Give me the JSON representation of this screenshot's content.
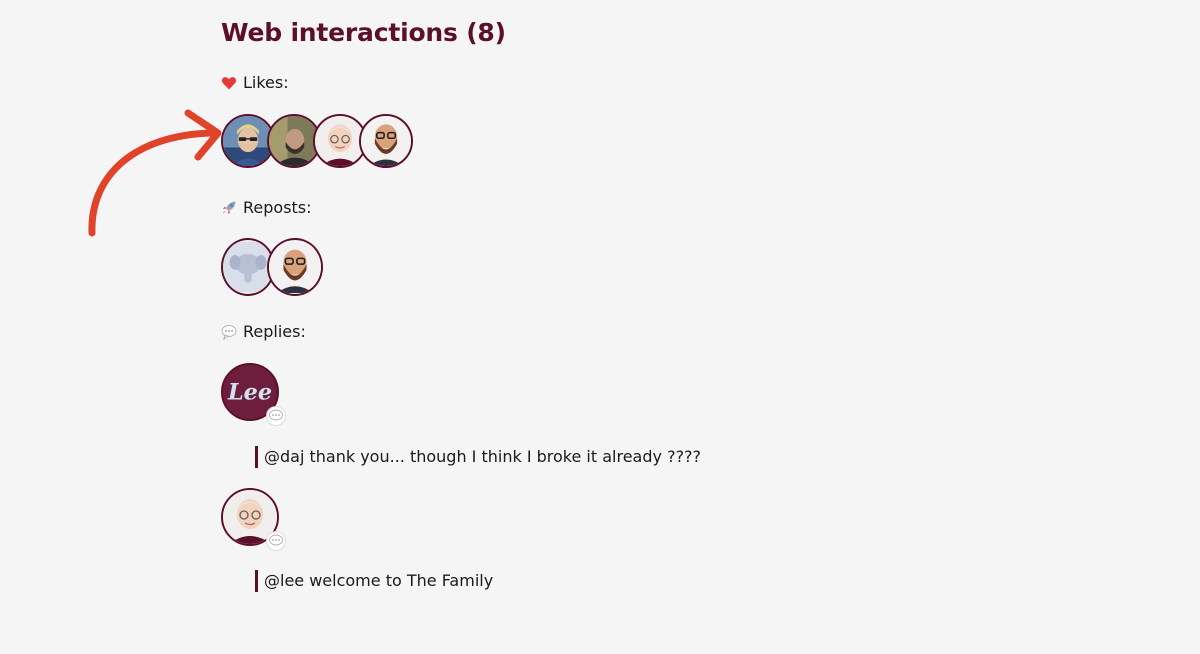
{
  "interactions": {
    "title": "Web interactions (8)",
    "likes": {
      "label": "Likes:",
      "icon": "heart-icon",
      "avatars": [
        "avatar-blonde-sunglasses",
        "avatar-beard-dark",
        "avatar-cartoon-bald-glasses",
        "avatar-cartoon-beard-glasses"
      ]
    },
    "reposts": {
      "label": "Reposts:",
      "icon": "rocket-icon",
      "avatars": [
        "avatar-mastodon-default",
        "avatar-cartoon-beard-glasses"
      ]
    },
    "replies": {
      "label": "Replies:",
      "icon": "speech-bubble-icon",
      "items": [
        {
          "avatar": "avatar-lee-logo",
          "avatar_text": "Lee",
          "text": "@daj thank you... though I think I broke it already ????"
        },
        {
          "avatar": "avatar-cartoon-bald-glasses",
          "text": "@lee welcome to The Family"
        }
      ]
    }
  },
  "colors": {
    "accent": "#5b0f2b",
    "background": "#f6f5f5",
    "arrow": "#e0432a"
  }
}
